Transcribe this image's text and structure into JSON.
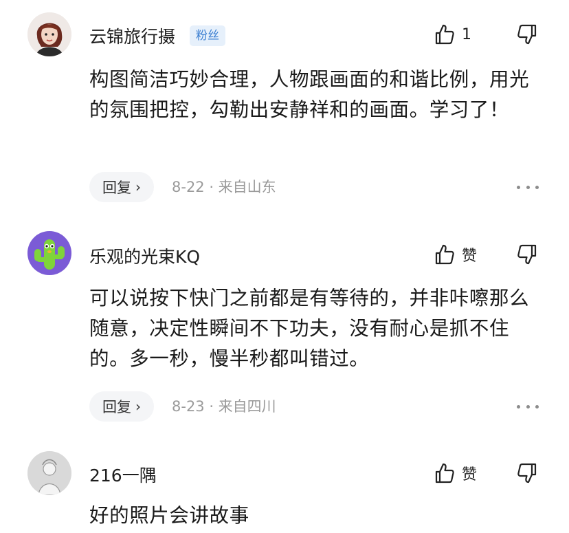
{
  "comments": [
    {
      "username": "云锦旅行摄",
      "badge": "粉丝",
      "like_label": "1",
      "content": "构图简洁巧妙合理，人物跟画面的和谐比例，用光的氛围把控，勾勒出安静祥和的画面。学习了！",
      "reply_label": "回复",
      "meta": "8-22 · 来自山东"
    },
    {
      "username": "乐观的光束KQ",
      "like_label": "赞",
      "content": "可以说按下快门之前都是有等待的，并非咔嚓那么随意，决定性瞬间不下功夫，没有耐心是抓不住的。多一秒，慢半秒都叫错过。",
      "reply_label": "回复",
      "meta": "8-23 · 来自四川"
    },
    {
      "username": "216一隅",
      "like_label": "赞",
      "content": "好的照片会讲故事"
    }
  ],
  "icons": {
    "like": "thumbs-up-icon",
    "dislike": "thumbs-down-icon",
    "chevron": "›",
    "more": "more-icon"
  },
  "colors": {
    "badge_bg": "#e6f0fb",
    "badge_text": "#3c7fd1",
    "meta_text": "#9a9a9a",
    "reply_bg": "#f4f5f7"
  }
}
